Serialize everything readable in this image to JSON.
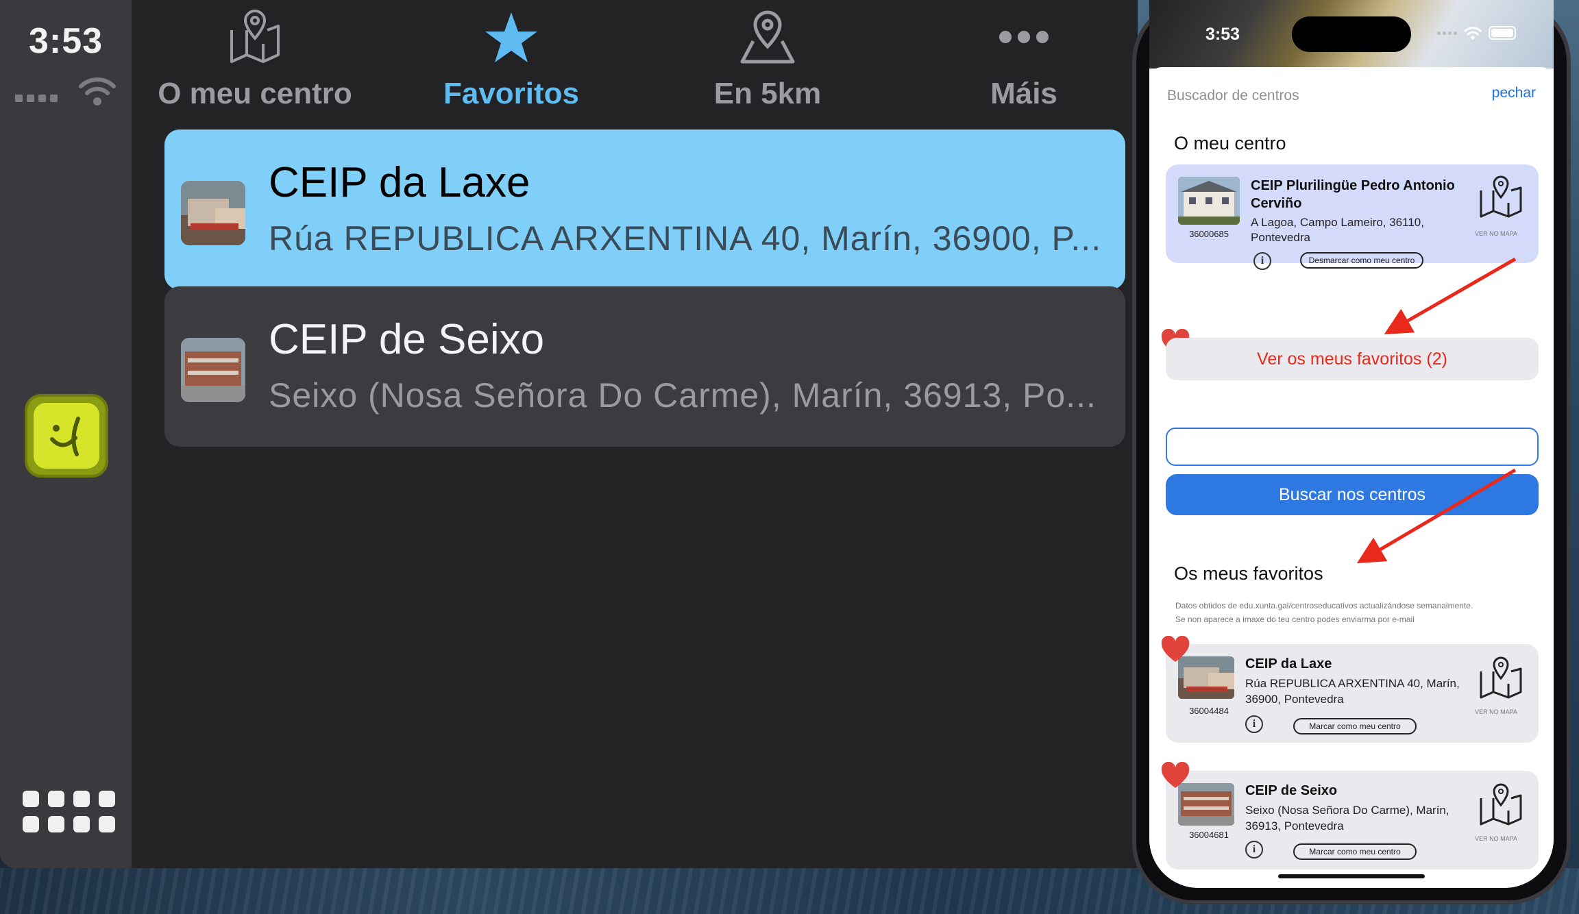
{
  "carplay": {
    "time": "3:53",
    "tabs": [
      {
        "label": "O meu centro",
        "icon": "map-pin-icon"
      },
      {
        "label": "Favoritos",
        "icon": "star-icon"
      },
      {
        "label": "En 5km",
        "icon": "location-pin-icon"
      },
      {
        "label": "Máis",
        "icon": "more-icon"
      }
    ],
    "active_tab": "Favoritos",
    "rows": [
      {
        "title": "CEIP da Laxe",
        "subtitle": "Rúa REPUBLICA ARXENTINA 40, Marín, 36900, P..."
      },
      {
        "title": "CEIP de Seixo",
        "subtitle": "Seixo (Nosa Señora Do Carme), Marín, 36913, Po..."
      }
    ],
    "colors": {
      "background": "#232326",
      "sidebar": "#3a3a3e",
      "selected_row": "#7fcff8",
      "accent": "#5ebcf3"
    }
  },
  "phone": {
    "time": "3:53",
    "sheet": {
      "title": "Buscador de centros",
      "close_label": "pechar",
      "my_center_heading": "O meu centro",
      "my_center": {
        "name": "CEIP Plurilingüe Pedro Antonio Cerviño",
        "address": "A Lagoa, Campo Lameiro, 36110, Pontevedra",
        "code": "36000685",
        "button": "Desmarcar como meu centro",
        "map_label": "VER NO MAPA"
      },
      "favorites_button": "Ver os meus favoritos (2)",
      "search_value": "",
      "search_button": "Buscar nos centros",
      "favorites_heading": "Os meus favoritos",
      "note_line1": "Datos obtidos de edu.xunta.gal/centroseducativos actualizándose semanalmente.",
      "note_line2": "Se non aparece a imaxe do teu centro podes enviarma por e-mail",
      "favorites": [
        {
          "name": "CEIP da Laxe",
          "address": "Rúa REPUBLICA ARXENTINA 40, Marín, 36900, Pontevedra",
          "code": "36004484",
          "button": "Marcar como meu centro",
          "map_label": "VER NO MAPA"
        },
        {
          "name": "CEIP de Seixo",
          "address": "Seixo (Nosa Señora Do Carme), Marín, 36913, Pontevedra",
          "code": "36004681",
          "button": "Marcar como meu centro",
          "map_label": "VER NO MAPA"
        }
      ]
    },
    "colors": {
      "link": "#1a73e8",
      "primary_button": "#2e78e2",
      "favorites_text": "#e8291c",
      "my_center_card": "#d4dbfa",
      "heart": "#e0433a"
    }
  }
}
